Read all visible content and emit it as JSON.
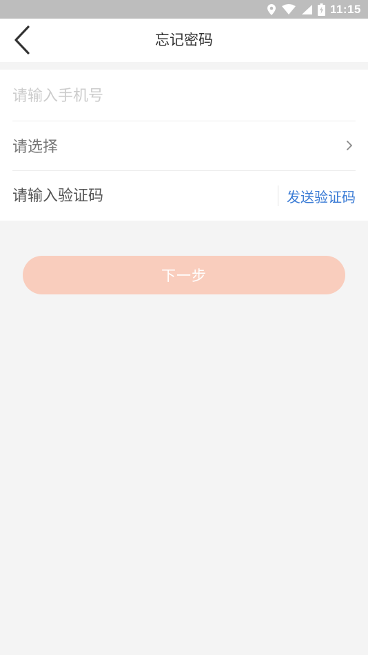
{
  "status_bar": {
    "time": "11:15",
    "icons": [
      "location-icon",
      "wifi-icon",
      "signal-icon",
      "battery-icon"
    ]
  },
  "header": {
    "title": "忘记密码",
    "back_icon": "chevron-left-icon"
  },
  "form": {
    "phone": {
      "placeholder": "请输入手机号",
      "value": ""
    },
    "select": {
      "text": "请选择",
      "icon": "chevron-right-icon"
    },
    "verification": {
      "placeholder": "请输入验证码",
      "value": "",
      "send_label": "发送验证码"
    }
  },
  "actions": {
    "next_label": "下一步"
  },
  "colors": {
    "accent_blue": "#3a7bd5",
    "button_bg": "#f9cdbd",
    "status_bar_bg": "#bdbdbd",
    "page_bg": "#f4f4f4"
  }
}
